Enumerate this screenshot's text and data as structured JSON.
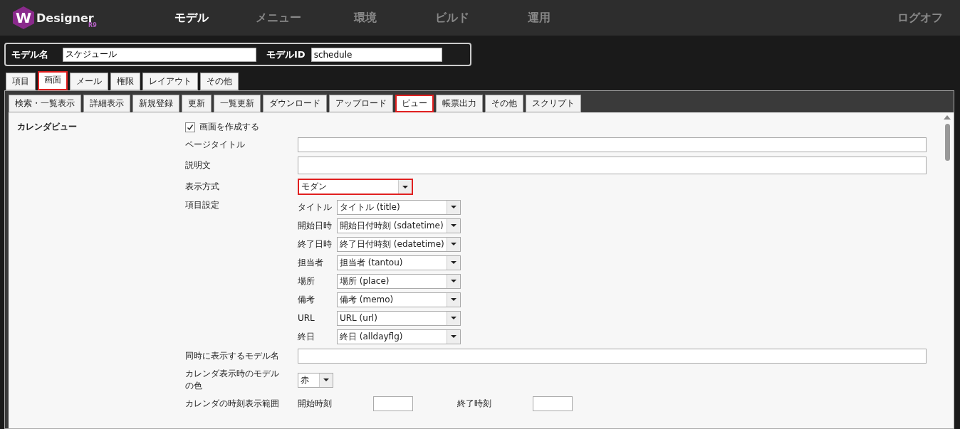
{
  "header": {
    "logo": {
      "mark": "W",
      "name": "Designer",
      "version": "R9"
    },
    "nav": [
      {
        "label": "モデル",
        "selected": true
      },
      {
        "label": "メニュー",
        "selected": false
      },
      {
        "label": "環境",
        "selected": false
      },
      {
        "label": "ビルド",
        "selected": false
      },
      {
        "label": "運用",
        "selected": false
      }
    ],
    "logoff": "ログオフ"
  },
  "model_bar": {
    "name_label": "モデル名",
    "name_value": "スケジュール",
    "id_label": "モデルID",
    "id_value": "schedule"
  },
  "tabs": [
    {
      "label": "項目",
      "selected": false
    },
    {
      "label": "画面",
      "selected": true
    },
    {
      "label": "メール",
      "selected": false
    },
    {
      "label": "権限",
      "selected": false
    },
    {
      "label": "レイアウト",
      "selected": false
    },
    {
      "label": "その他",
      "selected": false
    }
  ],
  "subtabs": [
    {
      "label": "検索・一覧表示",
      "selected": false
    },
    {
      "label": "詳細表示",
      "selected": false
    },
    {
      "label": "新規登録",
      "selected": false
    },
    {
      "label": "更新",
      "selected": false
    },
    {
      "label": "一覧更新",
      "selected": false
    },
    {
      "label": "ダウンロード",
      "selected": false
    },
    {
      "label": "アップロード",
      "selected": false
    },
    {
      "label": "ビュー",
      "selected": true
    },
    {
      "label": "帳票出力",
      "selected": false
    },
    {
      "label": "その他",
      "selected": false
    },
    {
      "label": "スクリプト",
      "selected": false
    }
  ],
  "section": {
    "title": "カレンダビュー",
    "create_checkbox": {
      "label": "画面を作成する",
      "checked": true
    },
    "page_title": {
      "label": "ページタイトル"
    },
    "description": {
      "label": "説明文"
    },
    "display_mode": {
      "label": "表示方式",
      "value": "モダン",
      "highlighted": true
    },
    "field_settings": {
      "label": "項目設定",
      "items": [
        {
          "label": "タイトル",
          "value": "タイトル (title)"
        },
        {
          "label": "開始日時",
          "value": "開始日付時刻 (sdatetime)"
        },
        {
          "label": "終了日時",
          "value": "終了日付時刻 (edatetime)"
        },
        {
          "label": "担当者",
          "value": "担当者 (tantou)"
        },
        {
          "label": "場所",
          "value": "場所 (place)"
        },
        {
          "label": "備考",
          "value": "備考 (memo)"
        },
        {
          "label": "URL",
          "value": "URL (url)"
        },
        {
          "label": "終日",
          "value": "終日 (alldayflg)"
        }
      ]
    },
    "concurrent_model": {
      "label": "同時に表示するモデル名"
    },
    "model_color": {
      "label": "カレンダ表示時のモデルの色",
      "value": "赤"
    },
    "time_range": {
      "label": "カレンダの時刻表示範囲",
      "start_label": "開始時刻",
      "end_label": "終了時刻"
    }
  }
}
